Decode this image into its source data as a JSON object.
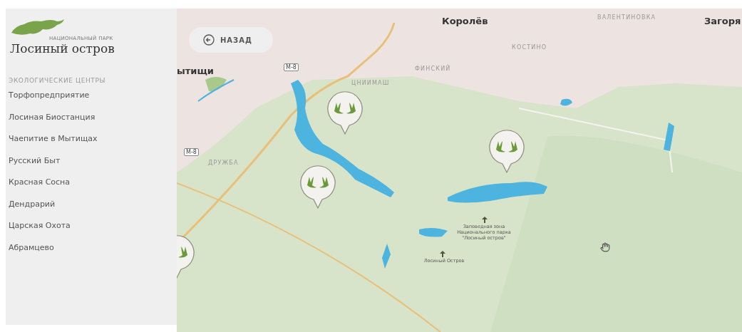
{
  "sidebar": {
    "logo": {
      "subtitle": "НАЦИОНАЛЬНЫЙ ПАРК",
      "title": "Лосиный остров"
    },
    "section": "ЭКОЛОГИЧЕСКИЕ ЦЕНТРЫ",
    "items": [
      "Торфопредприятие",
      "Лосиная Биостанция",
      "Чаепитие в Мытищах",
      "Русский Быт",
      "Красная Сосна",
      "Дендрарий",
      "Царская Охота",
      "Абрамцево"
    ]
  },
  "map": {
    "back_button": "НАЗАД",
    "labels": [
      {
        "text": "Королёв",
        "kind": "town"
      },
      {
        "text": "ВАЛЕНТИНОВКА",
        "kind": "district"
      },
      {
        "text": "Загоря",
        "kind": "town"
      },
      {
        "text": "КОСТИНО",
        "kind": "district"
      },
      {
        "text": "ФИНСКИЙ",
        "kind": "district"
      },
      {
        "text": "ЦНИИМАШ",
        "kind": "district"
      },
      {
        "text": "ытищи",
        "kind": "town"
      },
      {
        "text": "М-8",
        "kind": "road"
      },
      {
        "text": "М-8",
        "kind": "road"
      },
      {
        "text": "ДРУЖБА",
        "kind": "district"
      },
      {
        "text": "Заповедная зона Национального парка \"Лосиный остров\"",
        "kind": "poi"
      },
      {
        "text": "Лосиный Остров",
        "kind": "poi"
      }
    ]
  }
}
